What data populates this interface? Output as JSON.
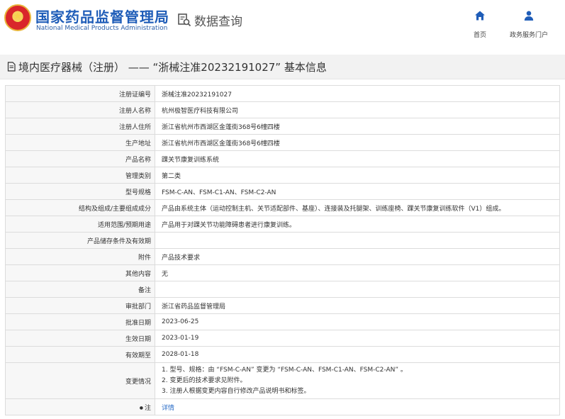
{
  "header": {
    "brand_cn": "国家药品监督管理局",
    "brand_en": "National Medical Products Administration",
    "section": "数据查询",
    "nav": [
      {
        "label": "首页",
        "icon": "home-icon"
      },
      {
        "label": "政务服务门户",
        "icon": "user-icon"
      }
    ]
  },
  "page_title": "境内医疗器械（注册） —— “浙械注准20232191027” 基本信息",
  "colors": {
    "brand_blue": "#1f5db8",
    "link_blue": "#2a6cc7",
    "label_bg": "#f7f7f7",
    "border": "#dcdcdc"
  },
  "rows": [
    {
      "label": "注册证编号",
      "value": "浙械注准20232191027"
    },
    {
      "label": "注册人名称",
      "value": "杭州极智医疗科技有限公司"
    },
    {
      "label": "注册人住所",
      "value": "浙江省杭州市西湖区金蓬街368号6幢四楼"
    },
    {
      "label": "生产地址",
      "value": "浙江省杭州市西湖区金蓬街368号6幢四楼"
    },
    {
      "label": "产品名称",
      "value": "踝关节康复训练系统"
    },
    {
      "label": "管理类别",
      "value": "第二类"
    },
    {
      "label": "型号规格",
      "value": "FSM-C-AN、FSM-C1-AN、FSM-C2-AN"
    },
    {
      "label": "结构及组成/主要组成成分",
      "value": "产品由系统主体（运动控制主机、关节适配部件、基座）、连接装及托腿架、训练座椅、踝关节康复训练软件（V1）组成。"
    },
    {
      "label": "适用范围/预期用途",
      "value": "产品用于对踝关节功能障碍患者进行康复训练。"
    },
    {
      "label": "产品储存条件及有效期",
      "value": ""
    },
    {
      "label": "附件",
      "value": "产品技术要求"
    },
    {
      "label": "其他内容",
      "value": "无"
    },
    {
      "label": "备注",
      "value": ""
    },
    {
      "label": "审批部门",
      "value": "浙江省药品监督管理局"
    },
    {
      "label": "批准日期",
      "value": "2023-06-25"
    },
    {
      "label": "生效日期",
      "value": "2023-01-19"
    },
    {
      "label": "有效期至",
      "value": "2028-01-18"
    }
  ],
  "changes": {
    "label": "变更情况",
    "lines": [
      "1. 型号、规格：由 “FSM-C-AN” 变更为 “FSM-C-AN、FSM-C1-AN、FSM-C2-AN” 。",
      "2. 变更后的技术要求见附件。",
      "3. 注册人根据变更内容自行修改产品说明书和标签。"
    ]
  },
  "note": {
    "label": "注",
    "link": "详情"
  }
}
